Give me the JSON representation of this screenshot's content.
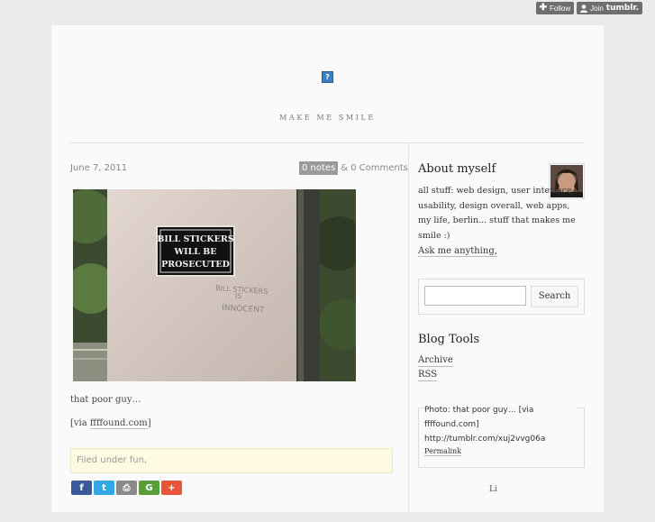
{
  "tumblr": {
    "follow_label": "Follow",
    "join_prefix": "Join",
    "join_brand": "tumblr."
  },
  "blog": {
    "title": "MAKE ME SMILE"
  },
  "post": {
    "date": "June 7, 2011",
    "notes_label": "0 notes",
    "notes_sep": "&",
    "comments_label": "0 Comments",
    "photo_sign_lines": [
      "BILL STICKERS",
      "WILL BE",
      "PROSECUTED"
    ],
    "photo_graffiti": [
      "BILL STICKERS",
      "IS",
      "INNOCENT"
    ],
    "caption": "that poor guy…",
    "via_prefix": "[via",
    "via_link": "ffffound.com",
    "via_suffix": "]",
    "filed_under": "Filed under fun,"
  },
  "sidebar": {
    "about_heading": "About myself",
    "about_text": "all stuff: web design, user interface, usability, design overall, web apps, my life, berlin... stuff that makes me smile :)",
    "ask_link": "Ask me anything,",
    "search_button": "Search",
    "tools_heading": "Blog Tools",
    "tools_links": [
      "Archive",
      "RSS"
    ],
    "recent_text": "Photo: that poor guy… [via ffffound.com] http://tumblr.com/xuj2vvg06a",
    "permalink": "Permalink",
    "bottom_fragment": "Li"
  },
  "share_icons": [
    {
      "name": "facebook-share-icon",
      "glyph": "f",
      "color": "#3b5998"
    },
    {
      "name": "twitter-share-icon",
      "glyph": "t",
      "color": "#33a6e6"
    },
    {
      "name": "print-share-icon",
      "glyph": "⎙",
      "color": "#8a8a8a"
    },
    {
      "name": "google-share-icon",
      "glyph": "G",
      "color": "#5a9e3a"
    },
    {
      "name": "addthis-share-icon",
      "glyph": "+",
      "color": "#e8553a"
    }
  ]
}
